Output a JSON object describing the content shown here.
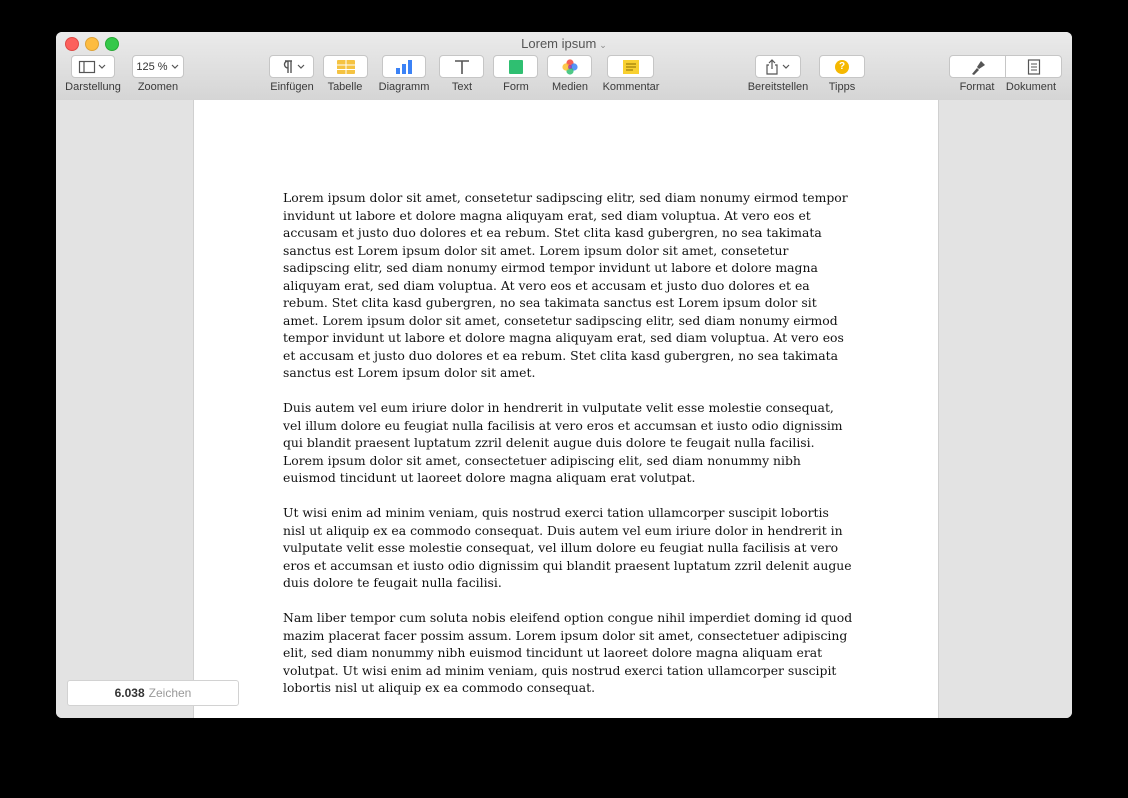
{
  "window": {
    "title": "Lorem ipsum"
  },
  "toolbar": {
    "darstellung_label": "Darstellung",
    "zoom_value": "125 %",
    "zoom_label": "Zoomen",
    "einfuegen_label": "Einfügen",
    "tabelle_label": "Tabelle",
    "diagramm_label": "Diagramm",
    "text_label": "Text",
    "form_label": "Form",
    "medien_label": "Medien",
    "kommentar_label": "Kommentar",
    "bereitstellen_label": "Bereitstellen",
    "tipps_label": "Tipps",
    "tipps_glyph": "?",
    "format_label": "Format",
    "dokument_label": "Dokument"
  },
  "document": {
    "paragraphs": [
      "Lorem ipsum dolor sit amet, consetetur sadipscing elitr, sed diam nonumy eirmod tempor invidunt ut labore et dolore magna aliquyam erat, sed diam voluptua. At vero eos et accusam et justo duo dolores et ea rebum. Stet clita kasd gubergren, no sea takimata sanctus est Lorem ipsum dolor sit amet. Lorem ipsum dolor sit amet, consetetur sadipscing elitr, sed diam nonumy eirmod tempor invidunt ut labore et dolore magna aliquyam erat, sed diam voluptua. At vero eos et accusam et justo duo dolores et ea rebum. Stet clita kasd gubergren, no sea takimata sanctus est Lorem ipsum dolor sit amet. Lorem ipsum dolor sit amet, consetetur sadipscing elitr, sed diam nonumy eirmod tempor invidunt ut labore et dolore magna aliquyam erat, sed diam voluptua. At vero eos et accusam et justo duo dolores et ea rebum. Stet clita kasd gubergren, no sea takimata sanctus est Lorem ipsum dolor sit amet.",
      "Duis autem vel eum iriure dolor in hendrerit in vulputate velit esse molestie consequat, vel illum dolore eu feugiat nulla facilisis at vero eros et accumsan et iusto odio dignissim qui blandit praesent luptatum zzril delenit augue duis dolore te feugait nulla facilisi. Lorem ipsum dolor sit amet, consectetuer adipiscing elit, sed diam nonummy nibh euismod tincidunt ut laoreet dolore magna aliquam erat volutpat.",
      "Ut wisi enim ad minim veniam, quis nostrud exerci tation ullamcorper suscipit lobortis nisl ut aliquip ex ea commodo consequat. Duis autem vel eum iriure dolor in hendrerit in vulputate velit esse molestie consequat, vel illum dolore eu feugiat nulla facilisis at vero eros et accumsan et iusto odio dignissim qui blandit praesent luptatum zzril delenit augue duis dolore te feugait nulla facilisi.",
      "Nam liber tempor cum soluta nobis eleifend option congue nihil imperdiet doming id quod mazim placerat facer possim assum. Lorem ipsum dolor sit amet, consectetuer adipiscing elit, sed diam nonummy nibh euismod tincidunt ut laoreet dolore magna aliquam erat volutpat. Ut wisi enim ad minim veniam, quis nostrud exerci tation ullamcorper suscipit lobortis nisl ut aliquip ex ea commodo consequat."
    ]
  },
  "status": {
    "char_count": "6.038",
    "char_unit": "Zeichen"
  },
  "colors": {
    "close": "#fc605c",
    "minimize": "#fdbc40",
    "maximize": "#34c84a",
    "table_icon": "#f5c342",
    "chart_icon": "#3b82f6",
    "shape_icon": "#2fbf71",
    "comment_icon": "#f8d030",
    "tips_icon": "#f5b800"
  },
  "icons": [
    "sidebar-view-icon",
    "chevron-down-icon",
    "paragraph-icon",
    "table-icon",
    "bar-chart-icon",
    "text-icon",
    "shape-icon",
    "media-icon",
    "comment-icon",
    "share-icon",
    "tips-icon",
    "format-brush-icon",
    "document-icon"
  ]
}
